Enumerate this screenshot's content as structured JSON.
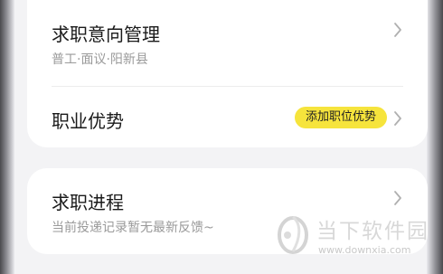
{
  "colors": {
    "background": "#f3f3f5",
    "card": "#ffffff",
    "badge": "#f6e43c",
    "title_text": "#1a1a1a",
    "subtitle_text": "#9a9a9a",
    "chevron": "#b0b0b0"
  },
  "job_intention": {
    "title": "求职意向管理",
    "subtitle": "普工·面议·阳新县",
    "icon": "chevron-right-icon"
  },
  "career_advantage": {
    "title": "职业优势",
    "badge": "添加职位优势",
    "icon": "chevron-right-icon"
  },
  "job_progress": {
    "title": "求职进程",
    "subtitle": "当前投递记录暂无最新反馈~",
    "icon": "chevron-right-icon"
  },
  "watermark": {
    "name": "当下软件园",
    "url": "www.downxia.com"
  }
}
